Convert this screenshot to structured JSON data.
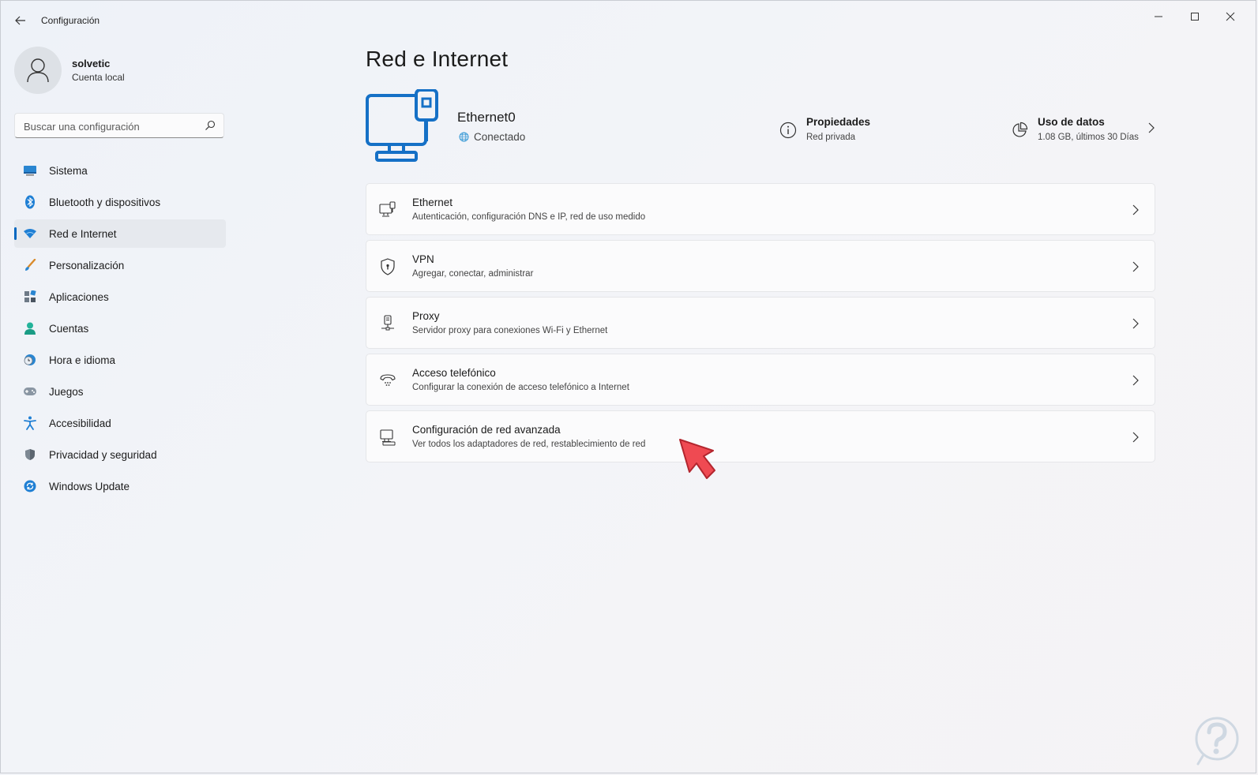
{
  "window": {
    "title": "Configuración"
  },
  "user": {
    "name": "solvetic",
    "account_type": "Cuenta local"
  },
  "search": {
    "placeholder": "Buscar una configuración"
  },
  "sidebar": {
    "items": [
      {
        "label": "Sistema",
        "icon": "system-icon"
      },
      {
        "label": "Bluetooth y dispositivos",
        "icon": "bluetooth-icon"
      },
      {
        "label": "Red e Internet",
        "icon": "wifi-icon",
        "active": true
      },
      {
        "label": "Personalización",
        "icon": "brush-icon"
      },
      {
        "label": "Aplicaciones",
        "icon": "apps-icon"
      },
      {
        "label": "Cuentas",
        "icon": "person-icon"
      },
      {
        "label": "Hora e idioma",
        "icon": "clock-globe-icon"
      },
      {
        "label": "Juegos",
        "icon": "gamepad-icon"
      },
      {
        "label": "Accesibilidad",
        "icon": "accessibility-icon"
      },
      {
        "label": "Privacidad y seguridad",
        "icon": "shield-icon"
      },
      {
        "label": "Windows Update",
        "icon": "update-icon"
      }
    ]
  },
  "main": {
    "title": "Red e Internet",
    "connection": {
      "name": "Ethernet0",
      "status": "Conectado"
    },
    "properties": {
      "title": "Propiedades",
      "subtitle": "Red privada"
    },
    "data_usage": {
      "title": "Uso de datos",
      "subtitle": "1.08 GB, últimos 30 Días"
    },
    "cards": [
      {
        "title": "Ethernet",
        "subtitle": "Autenticación, configuración DNS e IP, red de uso medido",
        "icon": "ethernet-icon"
      },
      {
        "title": "VPN",
        "subtitle": "Agregar, conectar, administrar",
        "icon": "vpn-shield-icon"
      },
      {
        "title": "Proxy",
        "subtitle": "Servidor proxy para conexiones Wi-Fi y Ethernet",
        "icon": "proxy-icon"
      },
      {
        "title": "Acceso telefónico",
        "subtitle": "Configurar la conexión de acceso telefónico a Internet",
        "icon": "phone-icon"
      },
      {
        "title": "Configuración de red avanzada",
        "subtitle": "Ver todos los adaptadores de red, restablecimiento de red",
        "icon": "advanced-network-icon"
      }
    ]
  },
  "colors": {
    "accent": "#0067c0",
    "hero_icon": "#1570c6",
    "cursor": "#e8404a"
  }
}
